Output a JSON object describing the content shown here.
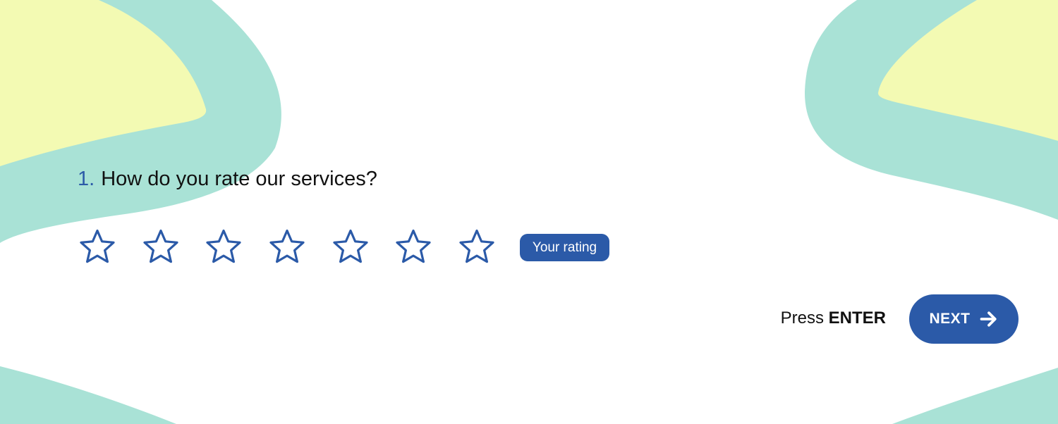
{
  "question": {
    "number": "1.",
    "text": "How do you rate our services?"
  },
  "rating": {
    "max_stars": 7,
    "selected": 0,
    "badge_label": "Your rating"
  },
  "hint": {
    "prefix": "Press",
    "key": "ENTER"
  },
  "next_button": {
    "label": "NEXT",
    "icon": "arrow-right-icon"
  },
  "colors": {
    "accent": "#2b5aa8",
    "mint": "#a9e2d6",
    "yellow": "#f3fab3",
    "background": "#ffffff"
  }
}
